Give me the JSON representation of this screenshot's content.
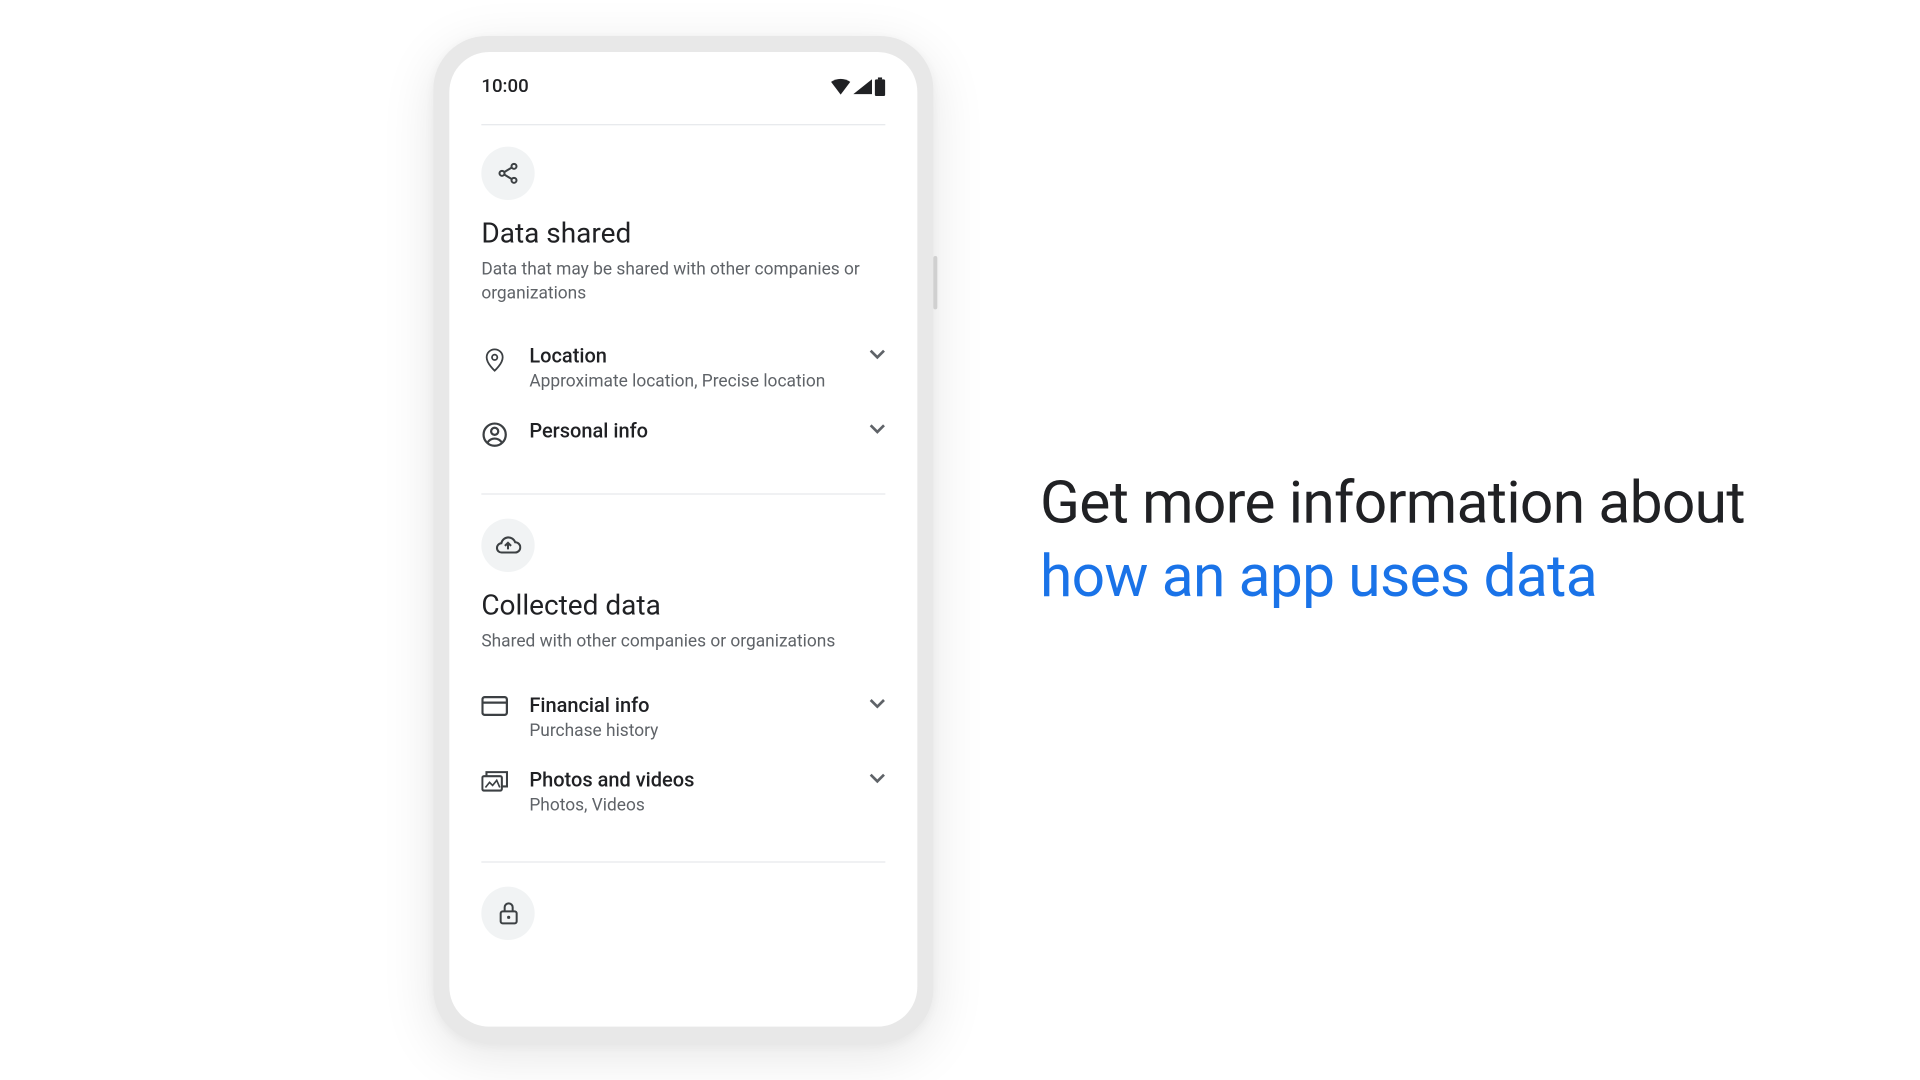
{
  "statusbar": {
    "time": "10:00"
  },
  "sections": {
    "shared": {
      "title": "Data shared",
      "subtitle": "Data that may be shared with other companies or organizations",
      "items": [
        {
          "title": "Location",
          "sub": "Approximate location, Precise location"
        },
        {
          "title": "Personal info",
          "sub": ""
        }
      ]
    },
    "collected": {
      "title": "Collected data",
      "subtitle": "Shared with other companies or organizations",
      "items": [
        {
          "title": "Financial info",
          "sub": "Purchase history"
        },
        {
          "title": "Photos and videos",
          "sub": "Photos, Videos"
        }
      ]
    }
  },
  "headline": {
    "line1": "Get more information about",
    "line2": "how an app uses data"
  },
  "colors": {
    "accent": "#1a73e8",
    "text": "#202124",
    "muted": "#5f6368"
  }
}
